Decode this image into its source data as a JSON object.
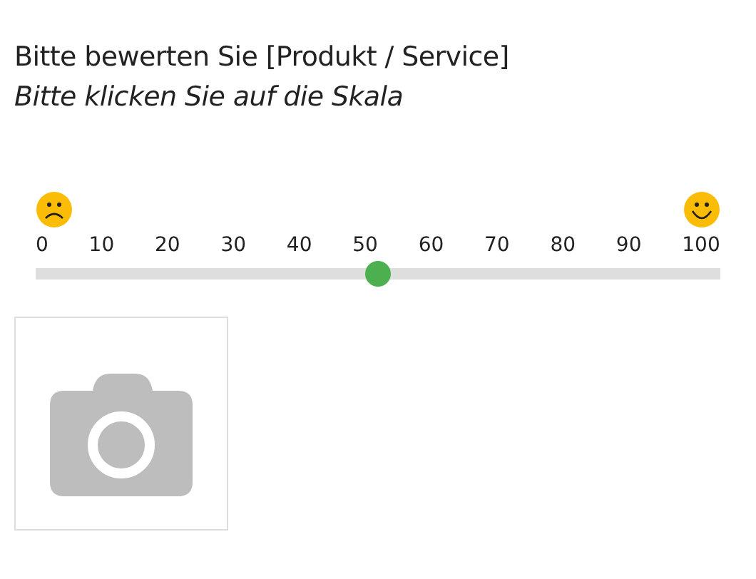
{
  "title": "Bitte bewerten Sie [Produkt / Service]",
  "instruction": "Bitte klicken Sie auf die Skala",
  "scale": {
    "labels": [
      "0",
      "10",
      "20",
      "30",
      "40",
      "50",
      "60",
      "70",
      "80",
      "90",
      "100"
    ],
    "level": 0.5
  },
  "photo": {
    "kind": "placeholder"
  }
}
